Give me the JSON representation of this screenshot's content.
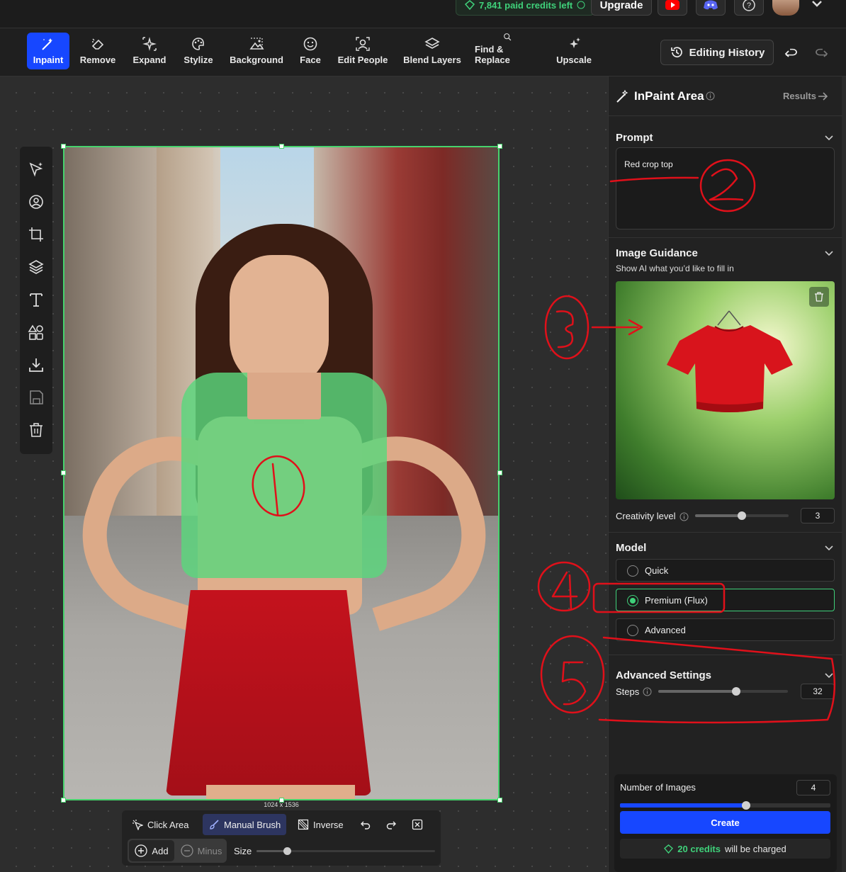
{
  "header": {
    "credits_text": "7,841 paid credits left",
    "upgrade_label": "Upgrade"
  },
  "toolbar": {
    "tools": [
      {
        "label": "Inpaint",
        "icon": "magic-wand-icon",
        "active": true
      },
      {
        "label": "Remove",
        "icon": "eraser-icon"
      },
      {
        "label": "Expand",
        "icon": "sparkle-expand-icon"
      },
      {
        "label": "Stylize",
        "icon": "palette-icon"
      },
      {
        "label": "Background",
        "icon": "image-background-icon"
      },
      {
        "label": "Face",
        "icon": "face-icon"
      },
      {
        "label": "Edit People",
        "icon": "edit-people-icon"
      },
      {
        "label": "Blend Layers",
        "icon": "layers-icon"
      },
      {
        "label": "Find & Replace",
        "icon": "search-icon"
      },
      {
        "label": "Upscale",
        "icon": "upscale-icon"
      }
    ],
    "editing_history_label": "Editing History"
  },
  "canvas": {
    "image_size_label": "1024 x 1536",
    "side_tools": [
      "select-sparkle-icon",
      "person-target-icon",
      "crop-icon",
      "layers-icon",
      "text-icon",
      "shapes-icon",
      "download-icon",
      "save-icon",
      "trash-icon"
    ],
    "brush_bar": {
      "click_area_label": "Click Area",
      "manual_brush_label": "Manual Brush",
      "inverse_label": "Inverse",
      "add_label": "Add",
      "minus_label": "Minus",
      "size_label": "Size",
      "size_value": 0.17
    }
  },
  "panel": {
    "title": "InPaint Area",
    "results_label": "Results",
    "prompt": {
      "title": "Prompt",
      "value": "Red crop top"
    },
    "image_guidance": {
      "title": "Image Guidance",
      "subtitle": "Show AI what you’d like to fill in",
      "creativity_label": "Creativity level",
      "creativity_value": "3",
      "creativity_fraction": 0.5
    },
    "model": {
      "title": "Model",
      "options": [
        {
          "label": "Quick",
          "selected": false
        },
        {
          "label": "Premium (Flux)",
          "selected": true
        },
        {
          "label": "Advanced",
          "selected": false
        }
      ]
    },
    "advanced_settings": {
      "title": "Advanced Settings",
      "steps_label": "Steps",
      "steps_value": "32",
      "steps_fraction": 0.6
    },
    "bottom": {
      "num_images_label": "Number of Images",
      "num_images_value": "4",
      "num_images_fraction": 0.6,
      "create_label": "Create",
      "charge_amount": "20 credits",
      "charge_suffix": "will be charged"
    }
  },
  "colors": {
    "accent_blue": "#1747ff",
    "accent_green": "#3fd17a",
    "annotation_red": "#e0101a"
  },
  "annotations": [
    "1",
    "2",
    "3",
    "4",
    "5"
  ]
}
